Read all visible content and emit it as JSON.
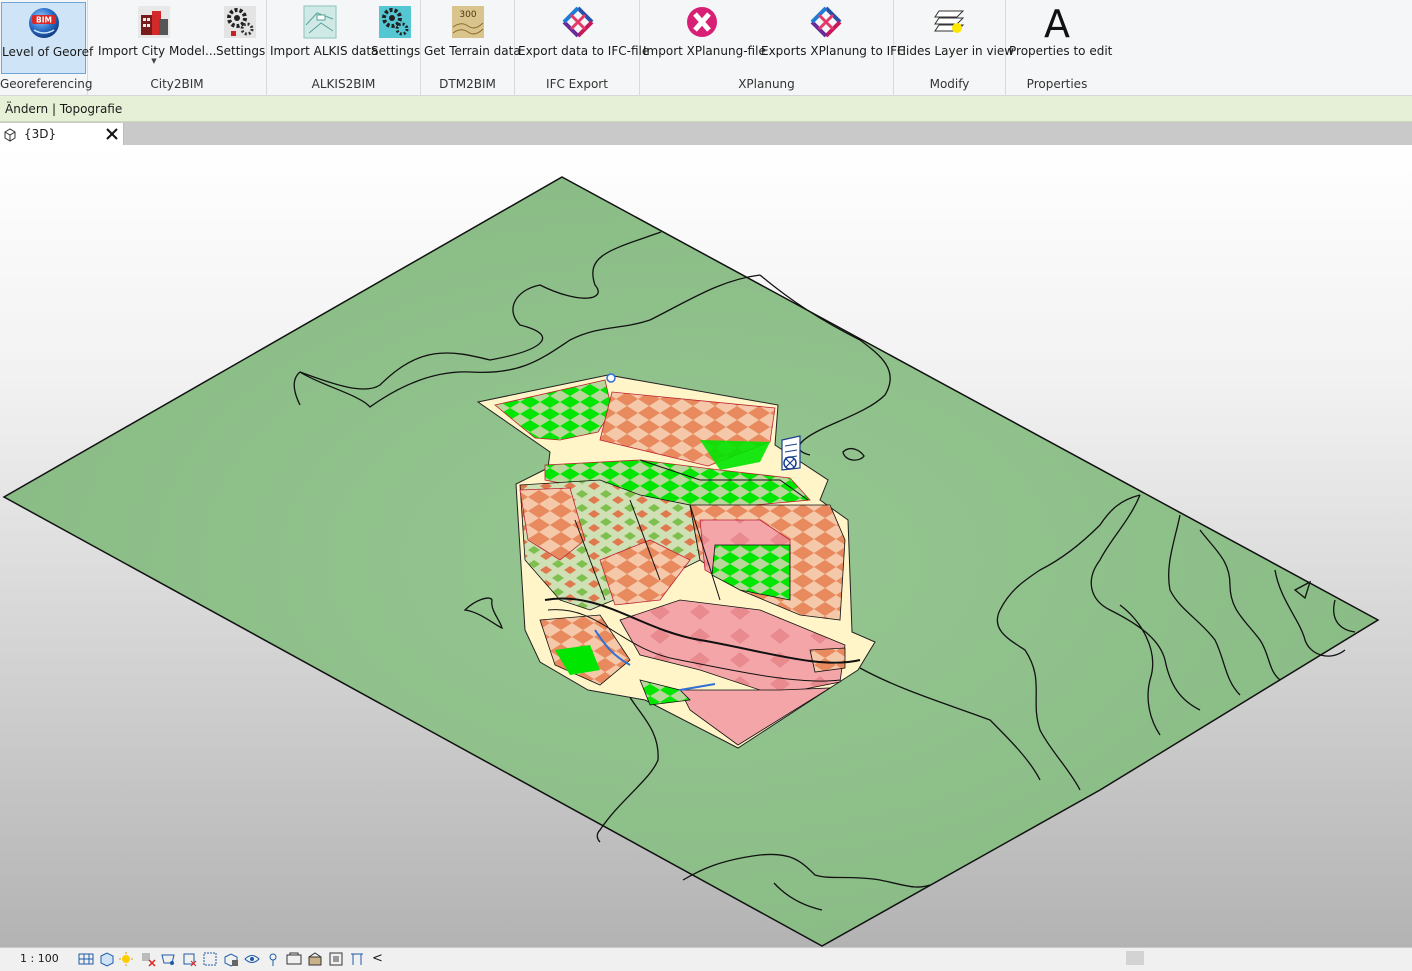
{
  "ribbon": {
    "panels": {
      "georeferencing": {
        "label": "Georeferencing",
        "buttons": {
          "level": "Level of Georef"
        }
      },
      "city2bim": {
        "label": "City2BIM",
        "buttons": {
          "import_city": "Import City Model...",
          "settings": "Settings"
        }
      },
      "alkis2bim": {
        "label": "ALKIS2BIM",
        "buttons": {
          "import_alkis": "Import ALKIS data",
          "settings": "Settings"
        }
      },
      "dtm2bim": {
        "label": "DTM2BIM",
        "buttons": {
          "terrain": "Get Terrain data"
        },
        "icon_text": "300"
      },
      "ifc_export": {
        "label": "IFC Export",
        "buttons": {
          "export_ifc": "Export data to IFC-file"
        }
      },
      "xplanung": {
        "label": "XPlanung",
        "buttons": {
          "import_xplan": "Import XPlanung-file",
          "export_xplan": "Exports XPlanung to IFC"
        }
      },
      "modify": {
        "label": "Modify",
        "buttons": {
          "hide_layer": "Hides Layer in view"
        }
      },
      "properties": {
        "label": "Properties",
        "buttons": {
          "props": "Properties to edit"
        },
        "icon_text": "A"
      }
    },
    "logo_text": "BIM"
  },
  "context_bar": {
    "text": "Ändern | Topografie"
  },
  "tabs": [
    {
      "label": "{3D}"
    }
  ],
  "status_bar": {
    "scale": "1 : 100"
  },
  "colors": {
    "terrain": "#8fbf8a",
    "site": "#fff5c8",
    "planting_green": "#00e600",
    "built_orange": "#e8895e",
    "pink_zone": "#f4a5a8",
    "context_bar": "#e6f0d6",
    "ribbon_active": "#cfe5f7"
  },
  "icons": {
    "level_of_georef": "bim-globe-icon",
    "import_city": "city-buildings-icon",
    "settings": "gears-icon",
    "alkis": "alkis-map-icon",
    "terrain": "terrain-contour-icon",
    "ifc": "ifc-logo-icon",
    "xplanung": "xplanung-x-icon",
    "hide_layer": "layers-sun-icon",
    "properties": "text-a-icon",
    "view3d": "cube-3d-icon",
    "close": "close-icon"
  }
}
